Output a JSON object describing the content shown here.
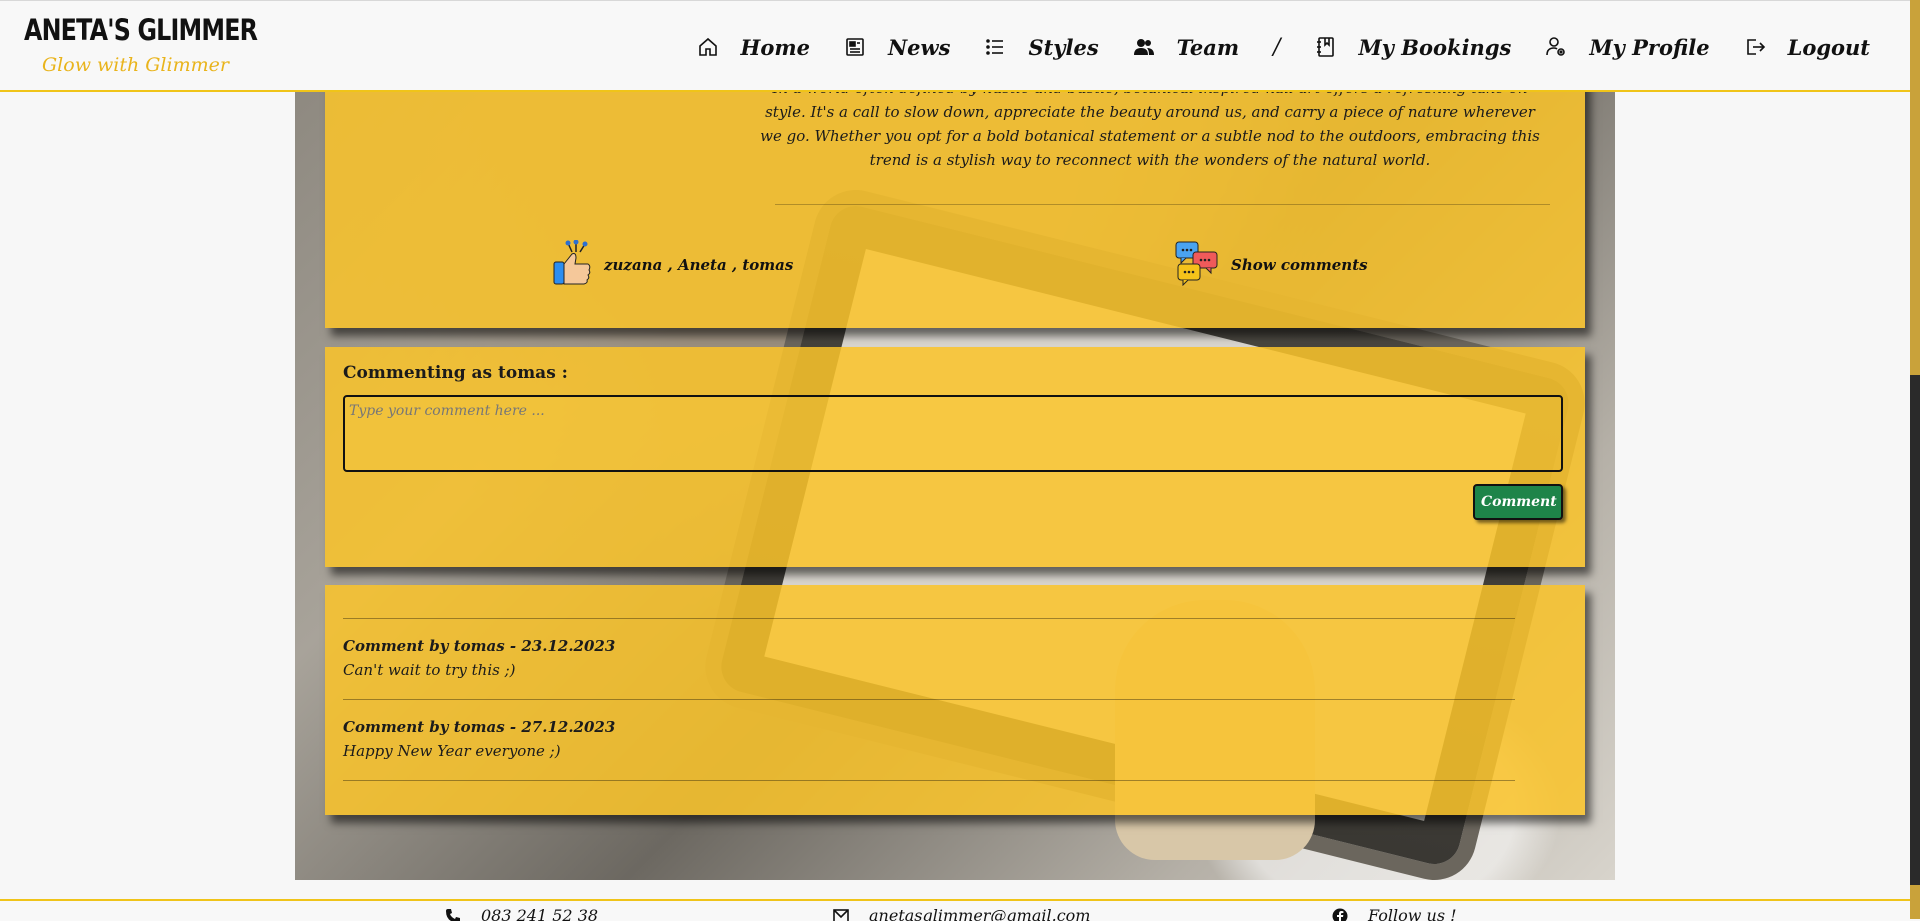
{
  "brand": {
    "name": "ANETA'S GLIMMER",
    "tagline": "Glow with Glimmer"
  },
  "nav": {
    "items": [
      {
        "label": "Home",
        "icon": "home-icon"
      },
      {
        "label": "News",
        "icon": "newspaper-icon"
      },
      {
        "label": "Styles",
        "icon": "list-icon"
      },
      {
        "label": "Team",
        "icon": "users-icon"
      },
      {
        "label": "My Bookings",
        "icon": "booklet-icon"
      },
      {
        "label": "My Profile",
        "icon": "user-gear-icon"
      },
      {
        "label": "Logout",
        "icon": "logout-icon"
      }
    ],
    "separator": "/"
  },
  "post": {
    "text": "In a world often defined by hustle and bustle, botanical inspired nail art offers a refreshing take on style. It's a call to slow down, appreciate the beauty around us, and carry a piece of nature wherever we go. Whether you opt for a bold botanical statement or a subtle nod to the outdoors, embracing this trend is a stylish way to reconnect with the wonders of the natural world.",
    "likes": "zuzana , Aneta , tomas",
    "show_comments": "Show comments"
  },
  "comment_form": {
    "label": "Commenting as tomas :",
    "placeholder": "Type your comment here ...",
    "button": "Comment"
  },
  "comments": [
    {
      "title": "Comment by tomas - 23.12.2023",
      "body": "Can't wait to try this ;)"
    },
    {
      "title": "Comment by tomas - 27.12.2023",
      "body": "Happy New Year everyone ;)"
    }
  ],
  "footer": {
    "phone": "083 241 52 38",
    "email": "anetasglimmer@gmail.com",
    "follow": "Follow us !"
  },
  "colors": {
    "accent": "#f0c419",
    "card": "#fac42a",
    "button": "#1e8449"
  }
}
